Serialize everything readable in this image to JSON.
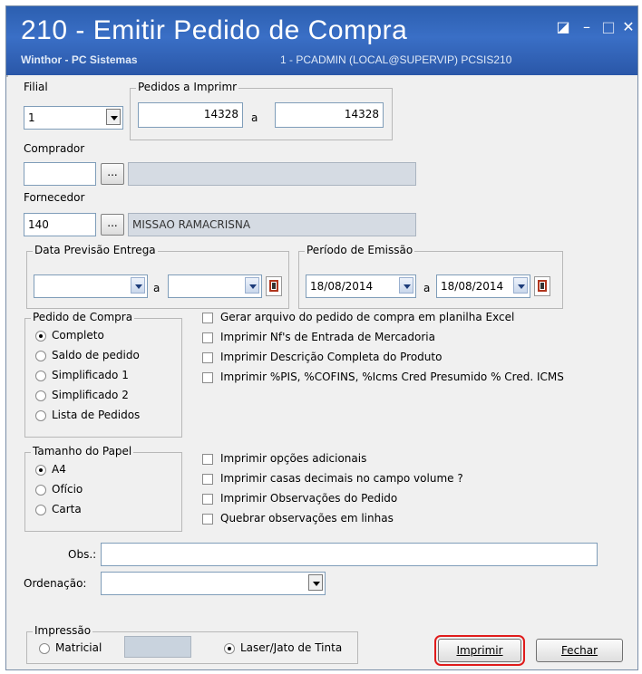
{
  "window": {
    "title": "210 - Emitir Pedido de Compra",
    "subtitle": "Winthor - PC Sistemas",
    "user_info": "1 - PCADMIN (LOCAL@SUPERVIP)  PCSIS210",
    "controls": {
      "help": "◪",
      "minimize": "–",
      "maximize": "□",
      "close": "✕"
    }
  },
  "filial": {
    "label": "Filial",
    "value": "1"
  },
  "pedidos": {
    "legend": "Pedidos a Imprimr",
    "from": "14328",
    "sep": "a",
    "to": "14328"
  },
  "comprador": {
    "label": "Comprador",
    "code": "",
    "button": "...",
    "name": ""
  },
  "fornecedor": {
    "label": "Fornecedor",
    "code": "140",
    "button": "...",
    "name": "MISSAO RAMACRISNA"
  },
  "data_previsao": {
    "legend": "Data Previsão Entrega",
    "from": "",
    "sep": "a",
    "to": ""
  },
  "periodo": {
    "legend": "Período de Emissão",
    "from": "18/08/2014",
    "sep": "a",
    "to": "18/08/2014"
  },
  "pedido_compra": {
    "legend": "Pedido de Compra",
    "options": [
      "Completo",
      "Saldo de pedido",
      "Simplificado 1",
      "Simplificado 2",
      "Lista de Pedidos"
    ],
    "selected": "Completo"
  },
  "options_top": [
    "Gerar arquivo do pedido de compra em planilha Excel",
    "Imprimir Nf's de Entrada de Mercadoria",
    "Imprimir Descrição Completa do Produto",
    "Imprimir %PIS, %COFINS, %Icms Cred Presumido % Cred. ICMS"
  ],
  "tamanho_papel": {
    "legend": "Tamanho do Papel",
    "options": [
      "A4",
      "Ofício",
      "Carta"
    ],
    "selected": "A4"
  },
  "options_bottom": [
    "Imprimir opções adicionais",
    "Imprimir casas decimais no campo volume ?",
    "Imprimir Observações do Pedido",
    "Quebrar observações em linhas"
  ],
  "obs": {
    "label": "Obs.:",
    "value": ""
  },
  "ordenacao": {
    "label": "Ordenação:",
    "value": ""
  },
  "impressao": {
    "legend": "Impressão",
    "option_matricial": "Matricial",
    "option_laser": "Laser/Jato de Tinta",
    "selected": "Laser/Jato de Tinta"
  },
  "buttons": {
    "print": "Imprimir",
    "close": "Fechar"
  },
  "colors": {
    "titlebar": "#2c5fb0",
    "highlight": "#e01b1b"
  }
}
